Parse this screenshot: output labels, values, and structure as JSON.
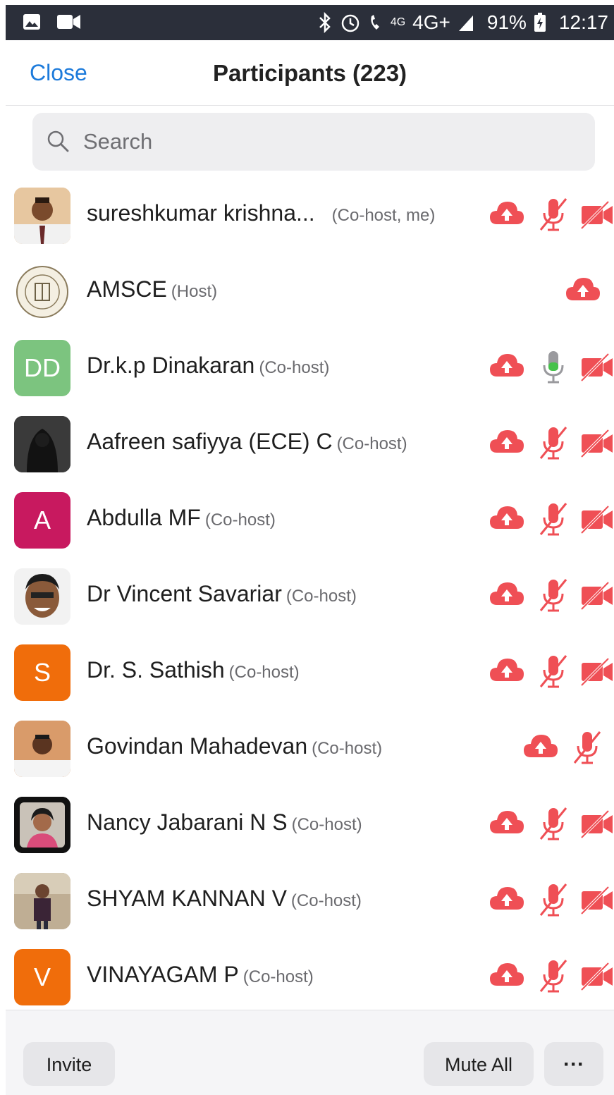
{
  "status_bar": {
    "network_small": "4G",
    "network": "4G+",
    "battery": "91%",
    "time": "12:17"
  },
  "header": {
    "close_label": "Close",
    "title": "Participants (223)"
  },
  "search": {
    "placeholder": "Search"
  },
  "participants": [
    {
      "name": "sureshkumar krishna...",
      "role": "(Co-host, me)",
      "avatar": "photo",
      "initials": ""
    },
    {
      "name": "AMSCE",
      "role": "(Host)",
      "avatar": "logo",
      "initials": ""
    },
    {
      "name": "Dr.k.p Dinakaran",
      "role": "(Co-host)",
      "avatar": "initials",
      "initials": "DD",
      "color": "#7cc47f"
    },
    {
      "name": "Aafreen safiyya (ECE) C",
      "role": "(Co-host)",
      "avatar": "photo",
      "initials": ""
    },
    {
      "name": "Abdulla MF",
      "role": "(Co-host)",
      "avatar": "initials",
      "initials": "A",
      "color": "#c8195f"
    },
    {
      "name": "Dr Vincent Savariar",
      "role": "(Co-host)",
      "avatar": "photo",
      "initials": ""
    },
    {
      "name": "Dr. S. Sathish",
      "role": "(Co-host)",
      "avatar": "initials",
      "initials": "S",
      "color": "#f06d0b"
    },
    {
      "name": "Govindan Mahadevan",
      "role": "(Co-host)",
      "avatar": "photo",
      "initials": ""
    },
    {
      "name": "Nancy Jabarani N S",
      "role": "(Co-host)",
      "avatar": "photo",
      "initials": ""
    },
    {
      "name": "SHYAM KANNAN V",
      "role": "(Co-host)",
      "avatar": "photo",
      "initials": ""
    },
    {
      "name": "VINAYAGAM P",
      "role": "(Co-host)",
      "avatar": "initials",
      "initials": "V",
      "color": "#f06d0b"
    }
  ],
  "bottom_bar": {
    "invite_label": "Invite",
    "mute_all_label": "Mute All",
    "more_label": "···"
  },
  "colors": {
    "accent": "#1d7bdb",
    "muted_red": "#ef4f55",
    "unmuted_green": "#46c24b"
  }
}
